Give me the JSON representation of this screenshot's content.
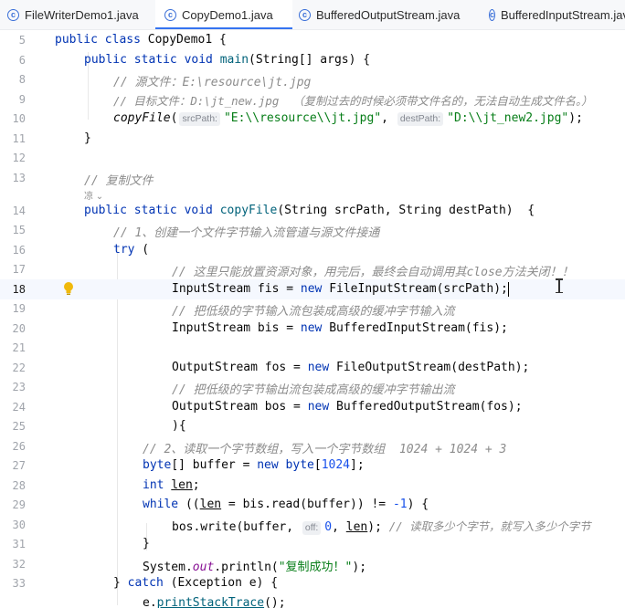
{
  "tabs": [
    {
      "label": "FileWriterDemo1.java",
      "active": false
    },
    {
      "label": "CopyDemo1.java",
      "active": true
    },
    {
      "label": "BufferedOutputStream.java",
      "active": false
    },
    {
      "label": "BufferedInputStream.java",
      "active": false
    }
  ],
  "tab_icon_glyph": "c",
  "author_hint": "凉 ⌄",
  "editor": {
    "current_line": "18",
    "params": {
      "src": "srcPath:",
      "dest": "destPath:",
      "off": "off:"
    },
    "lines": {
      "l5": {
        "no": "5",
        "kw1": "public class ",
        "rest": "CopyDemo1 {"
      },
      "l6": {
        "no": "6",
        "kw1": "public static void ",
        "fn": "main",
        "rest": "(String[] args) {"
      },
      "l8": {
        "no": "8",
        "c": "// 源文件：E:\\resource\\jt.jpg"
      },
      "l9": {
        "no": "9",
        "c": "// 目标文件：D:\\jt_new.jpg  （复制过去的时候必须带文件名的，无法自动生成文件名。）"
      },
      "l10": {
        "no": "10",
        "fn": "copyFile",
        "p1": "(",
        "s1": "\"E:\\\\resource\\\\jt.jpg\"",
        "p2": ",",
        "s2": "\"D:\\\\jt_new2.jpg\"",
        "p3": ");"
      },
      "l11": {
        "no": "11",
        "t": "}"
      },
      "l12": {
        "no": "12"
      },
      "l13": {
        "no": "13",
        "c": "// 复制文件"
      },
      "l14": {
        "no": "14",
        "kw1": "public static void ",
        "fn": "copyFile",
        "rest": "(String srcPath, String destPath)  {"
      },
      "l15": {
        "no": "15",
        "c": "// 1、创建一个文件字节输入流管道与源文件接通"
      },
      "l16": {
        "no": "16",
        "kw1": "try",
        "rest": " ("
      },
      "l17": {
        "no": "17",
        "c": "// 这里只能放置资源对象，用完后，最终会自动调用其close方法关闭！！"
      },
      "l18": {
        "no": "18",
        "a": "InputStream fis = ",
        "kw1": "new",
        "rest": " FileInputStream(srcPath);"
      },
      "l19": {
        "no": "19",
        "c": "// 把低级的字节输入流包装成高级的缓冲字节输入流"
      },
      "l20": {
        "no": "20",
        "a": "InputStream bis = ",
        "kw1": "new",
        "rest": " BufferedInputStream(fis);"
      },
      "l21": {
        "no": "21"
      },
      "l22": {
        "no": "22",
        "a": "OutputStream fos = ",
        "kw1": "new",
        "rest": " FileOutputStream(destPath);"
      },
      "l23": {
        "no": "23",
        "c": "// 把低级的字节输出流包装成高级的缓冲字节输出流"
      },
      "l24": {
        "no": "24",
        "a": "OutputStream bos = ",
        "kw1": "new",
        "rest": " BufferedOutputStream(fos);"
      },
      "l25": {
        "no": "25",
        "t": "){"
      },
      "l26": {
        "no": "26",
        "c": "// 2、读取一个字节数组，写入一个字节数组  1024 + 1024 + 3"
      },
      "l27": {
        "no": "27",
        "a": "byte",
        "b": "[] buffer = ",
        "kw1": "new byte",
        "c1": "[",
        "n": "1024",
        "d": "];"
      },
      "l28": {
        "no": "28",
        "kw1": "int ",
        "v": "len",
        "rest": ";"
      },
      "l29": {
        "no": "29",
        "kw1": "while",
        "p": " ((",
        "v": "len",
        "q": " = bis.read(buffer)) != ",
        "n": "-1",
        "rest": ") {"
      },
      "l30": {
        "no": "30",
        "a": "bos.write(buffer, ",
        "n": "0",
        "b": ", ",
        "v": "len",
        "d": "); ",
        "c": "// 读取多少个字节，就写入多少个字节"
      },
      "l31": {
        "no": "31",
        "t": "}"
      },
      "l32": {
        "no": "32",
        "a": "System.",
        "f": "out",
        "b": ".println(",
        "s": "\"复制成功！\"",
        "d": ");"
      },
      "l33": {
        "no": "33",
        "a": "} ",
        "kw1": "catch",
        "rest": " (Exception e) {"
      },
      "l34": {
        "no": "",
        "a": "e.",
        "fn": "printStackTrace",
        "rest": "();"
      }
    }
  }
}
